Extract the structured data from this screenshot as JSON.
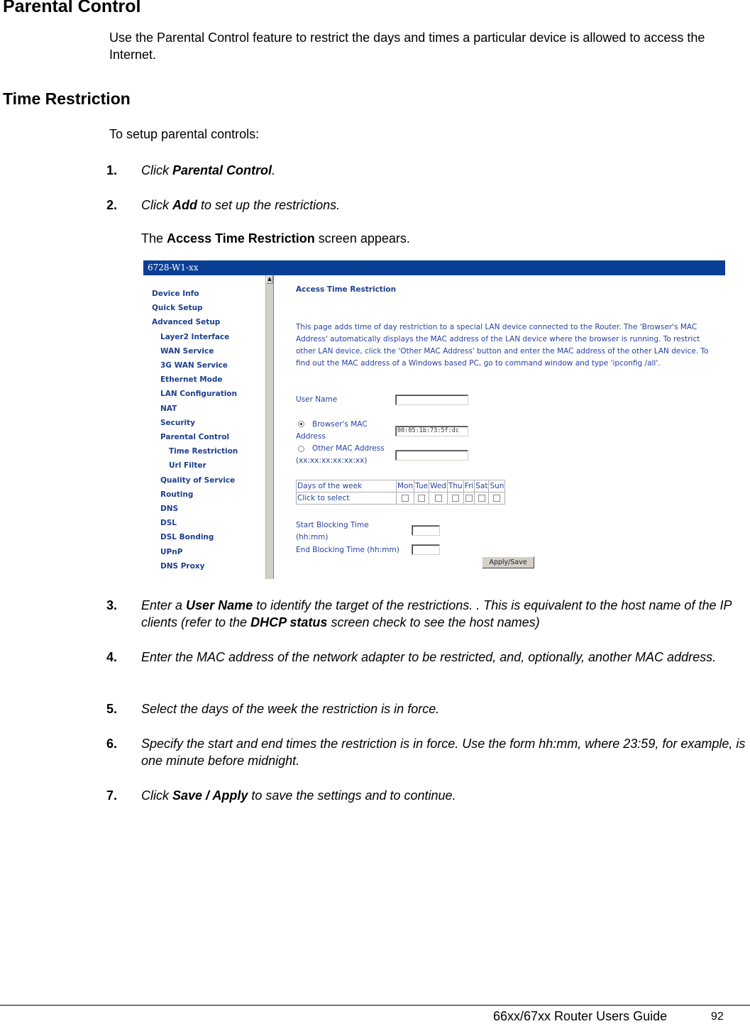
{
  "heading": "Parental Control",
  "intro": "Use the Parental Control feature to restrict the days and times a particular device is allowed to access the Internet.",
  "subheading": "Time Restriction",
  "setup_text": "To setup parental controls:",
  "steps": [
    {
      "num": "1.",
      "parts": [
        {
          "t": "Click ",
          "b": false
        },
        {
          "t": "Parental Control",
          "b": true
        },
        {
          "t": ".",
          "b": false
        }
      ]
    },
    {
      "num": "2.",
      "parts": [
        {
          "t": "Click ",
          "b": false
        },
        {
          "t": "Add",
          "b": true
        },
        {
          "t": " to set up the restrictions.",
          "b": false
        }
      ]
    },
    {
      "num": "3.",
      "parts": [
        {
          "t": "Enter a ",
          "b": false
        },
        {
          "t": "User Name",
          "b": true
        },
        {
          "t": " to identify the target of the restrictions. .  This is equivalent to the host name of the IP clients (refer to the ",
          "b": false
        },
        {
          "t": "DHCP status",
          "b": true
        },
        {
          "t": " screen check to see the host names)",
          "b": false
        }
      ]
    },
    {
      "num": "4.",
      "parts": [
        {
          "t": "Enter the MAC address of the network adapter to be restricted, and, optionally, another MAC address.",
          "b": false
        }
      ]
    },
    {
      "num": "5.",
      "parts": [
        {
          "t": "Select the days of the week the restriction is in force.",
          "b": false
        }
      ]
    },
    {
      "num": "6.",
      "parts": [
        {
          "t": "Specify the start and end times the restriction is in force. Use the form hh:mm, where 23:59, for example, is one minute before midnight.",
          "b": false
        }
      ]
    },
    {
      "num": "7.",
      "parts": [
        {
          "t": "Click ",
          "b": false
        },
        {
          "t": "Save / Apply",
          "b": true
        },
        {
          "t": " to save the settings and to continue.",
          "b": false
        }
      ]
    }
  ],
  "screen_appears": {
    "pre": "The ",
    "bold": "Access Time Restriction",
    "post": " screen appears."
  },
  "screenshot": {
    "window_title": "6728-W1-xx",
    "nav": [
      {
        "label": "Device Info",
        "level": 0
      },
      {
        "label": "Quick Setup",
        "level": 0
      },
      {
        "label": "Advanced Setup",
        "level": 0
      },
      {
        "label": "Layer2 Interface",
        "level": 1
      },
      {
        "label": "WAN Service",
        "level": 1
      },
      {
        "label": "3G WAN Service",
        "level": 1
      },
      {
        "label": "Ethernet Mode",
        "level": 1
      },
      {
        "label": "LAN Configuration",
        "level": 1
      },
      {
        "label": "NAT",
        "level": 1
      },
      {
        "label": "Security",
        "level": 1
      },
      {
        "label": "Parental Control",
        "level": 1
      },
      {
        "label": "Time Restriction",
        "level": 2
      },
      {
        "label": "Url Filter",
        "level": 2
      },
      {
        "label": "Quality of Service",
        "level": 1
      },
      {
        "label": "Routing",
        "level": 1
      },
      {
        "label": "DNS",
        "level": 1
      },
      {
        "label": "DSL",
        "level": 1
      },
      {
        "label": "DSL Bonding",
        "level": 1
      },
      {
        "label": "UPnP",
        "level": 1
      },
      {
        "label": "DNS Proxy",
        "level": 1
      }
    ],
    "page_title": "Access Time Restriction",
    "description": "This page adds time of day restriction to a special LAN device connected to the Router. The 'Browser's MAC Address' automatically displays the MAC address of the LAN device where the browser is running. To restrict other LAN device, click the 'Other MAC Address' button and enter the MAC address of the other LAN device. To find out the MAC address of a Windows based PC, go to command window and type 'ipconfig /all'.",
    "user_name_label": "User Name",
    "user_name_value": "",
    "browser_mac_label_1": "Browser's MAC",
    "browser_mac_label_2": "Address",
    "browser_mac_value": "00:05:1b:73:5f:dc",
    "browser_mac_selected": true,
    "other_mac_label": "Other MAC Address",
    "other_mac_hint": "(xx:xx:xx:xx:xx:xx)",
    "other_mac_value": "",
    "days_header": "Days of the week",
    "days_row_label": "Click to select",
    "days": [
      "Mon",
      "Tue",
      "Wed",
      "Thu",
      "Fri",
      "Sat",
      "Sun"
    ],
    "days_checked": [
      false,
      false,
      false,
      false,
      false,
      false,
      false
    ],
    "start_label_1": "Start Blocking Time",
    "start_label_2": "(hh:mm)",
    "start_value": "",
    "end_label": "End Blocking Time (hh:mm)",
    "end_value": "",
    "apply_button": "Apply/Save"
  },
  "footer": {
    "title": "66xx/67xx Router Users Guide",
    "page": "92"
  }
}
